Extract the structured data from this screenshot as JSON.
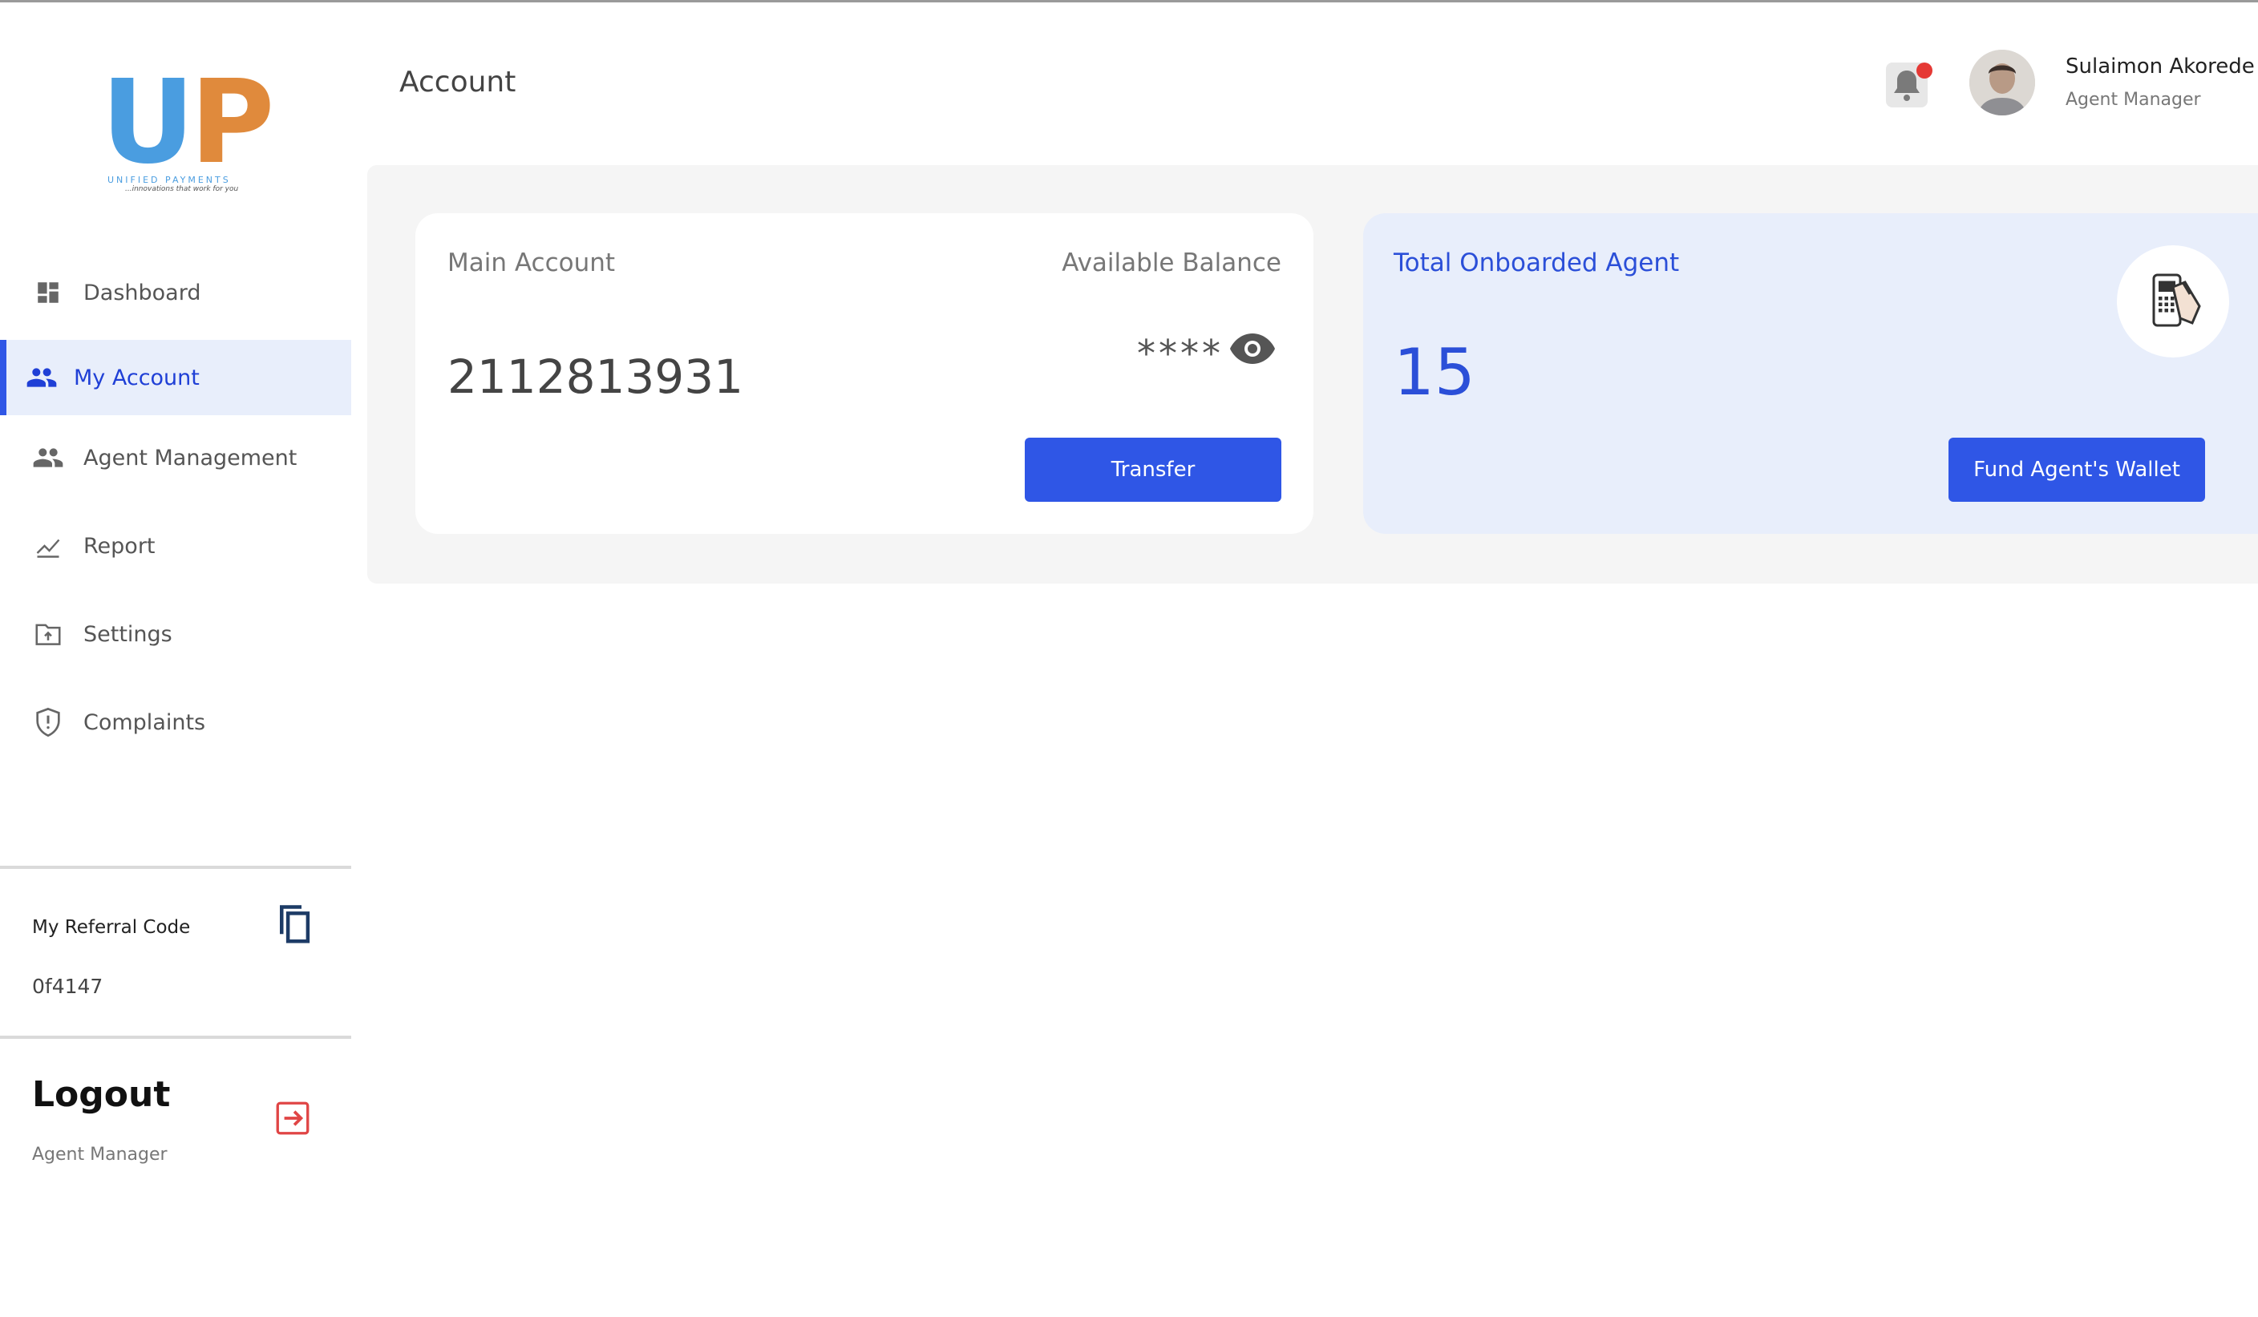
{
  "brand": {
    "logo_letters_1": "U",
    "logo_letters_2": "P",
    "tagline_1": "UNIFIED PAYMENTS",
    "tagline_2": "...innovations that work for you"
  },
  "sidebar": {
    "items": [
      {
        "label": "Dashboard",
        "icon": "dashboard-icon"
      },
      {
        "label": "My Account",
        "icon": "people-icon",
        "active": true
      },
      {
        "label": "Agent Management",
        "icon": "people-icon"
      },
      {
        "label": "Report",
        "icon": "chart-line-icon"
      },
      {
        "label": "Settings",
        "icon": "folder-upload-icon"
      },
      {
        "label": "Complaints",
        "icon": "shield-alert-icon"
      }
    ],
    "referral_label": "My Referral Code",
    "referral_code": "0f4147",
    "logout_label": "Logout",
    "logout_role": "Agent Manager"
  },
  "header": {
    "title": "Account",
    "user_name": "Sulaimon Akorede",
    "user_role": "Agent Manager"
  },
  "account_card": {
    "label": "Main Account",
    "balance_label": "Available Balance",
    "account_number": "2112813931",
    "masked_balance": "****",
    "button_label": "Transfer"
  },
  "agent_card": {
    "label": "Total Onboarded Agent",
    "count": "15",
    "button_label": "Fund Agent's Wallet"
  },
  "colors": {
    "accent": "#2f56e6",
    "active_bg": "#e8eefb",
    "notification_dot": "#e53935",
    "logout_icon": "#e04545"
  }
}
